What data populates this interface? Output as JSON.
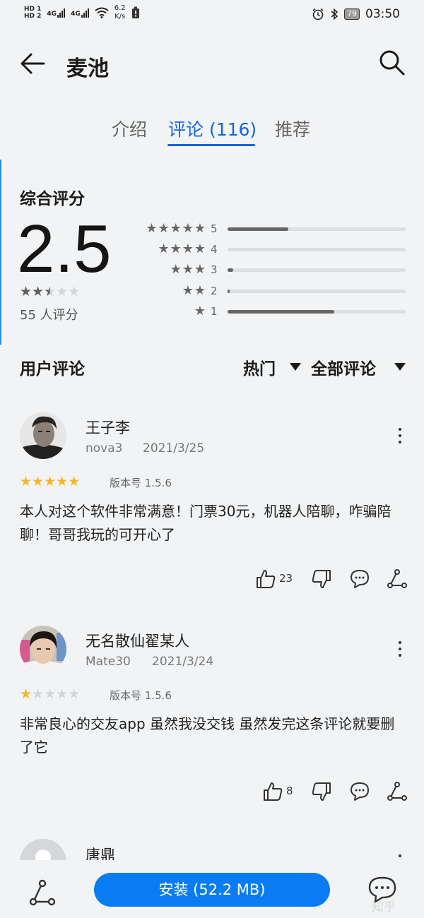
{
  "status_bar": {
    "hd1": "HD 1",
    "hd2": "HD 2",
    "net1": "4G",
    "net2": "4G",
    "speed_value": "6.2",
    "speed_unit": "K/s",
    "battery": "79",
    "time": "03:50"
  },
  "header": {
    "title": "麦池",
    "back_icon": "back-arrow-icon",
    "search_icon": "search-icon"
  },
  "tabs": [
    {
      "label": "介绍",
      "active": false
    },
    {
      "label": "评论 (116)",
      "active": true
    },
    {
      "label": "推荐",
      "active": false
    }
  ],
  "rating": {
    "heading": "综合评分",
    "score": "2.5",
    "stars_value": 2.5,
    "count_text": "55 人评分",
    "distribution": [
      {
        "stars": 5,
        "label": "5",
        "fraction": 0.34
      },
      {
        "stars": 4,
        "label": "4",
        "fraction": 0.0
      },
      {
        "stars": 3,
        "label": "3",
        "fraction": 0.03
      },
      {
        "stars": 2,
        "label": "2",
        "fraction": 0.01
      },
      {
        "stars": 1,
        "label": "1",
        "fraction": 0.6
      }
    ]
  },
  "user_reviews": {
    "heading": "用户评论",
    "sort_label": "热门",
    "filter_label": "全部评论"
  },
  "reviews": [
    {
      "name": "王子李",
      "device": "nova3",
      "date": "2021/3/25",
      "stars": 5,
      "version": "版本号 1.5.6",
      "text": "本人对这个软件非常满意！门票30元，机器人陪聊，咋骗陪聊！哥哥我玩的可开心了",
      "likes": "23"
    },
    {
      "name": "无名散仙翟某人",
      "device": "Mate30",
      "date": "2021/3/24",
      "stars": 1,
      "version": "版本号 1.5.6",
      "text": "非常良心的交友app 虽然我没交钱 虽然发完这条评论就要删了它",
      "likes": "8"
    }
  ],
  "partial_review": {
    "name": "唐鼎"
  },
  "bottom": {
    "install_label": "安装 (52.2 MB)",
    "share_icon": "share-icon",
    "chat_icon": "chat-bubble-icon",
    "watermark": "知乎"
  },
  "colors": {
    "accent": "#1466d8",
    "install_button": "#0a7cf2",
    "star_gold": "#f2b824",
    "star_gray": "#5e5e5e",
    "star_empty": "#d4d6d9"
  }
}
